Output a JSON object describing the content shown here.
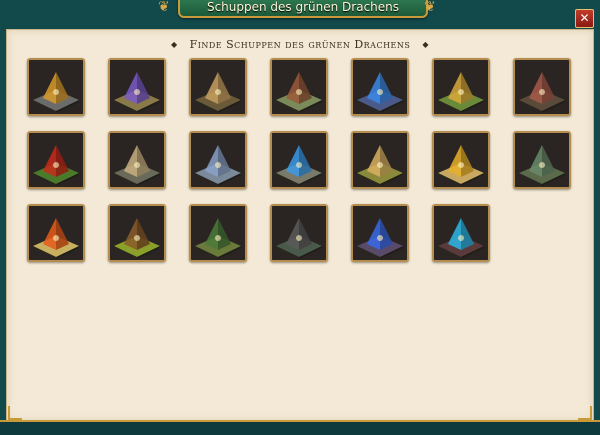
{
  "window": {
    "title": "Schuppen des grünen Drachens",
    "close_label": "✕"
  },
  "heading": {
    "text": "Finde Schuppen des grünen Drachens",
    "bullet": "◆"
  },
  "tiles": [
    {
      "icon": "lava-mountain-icon",
      "accent": "#d89a2a",
      "ground": "#6b6b6b"
    },
    {
      "icon": "horned-fortress-icon",
      "accent": "#7a5ac8",
      "ground": "#8a7a4a"
    },
    {
      "icon": "cathedral-icon",
      "accent": "#c8a060",
      "ground": "#6a5a3a"
    },
    {
      "icon": "ruined-village-icon",
      "accent": "#9a5a3a",
      "ground": "#7a8a5a"
    },
    {
      "icon": "blue-crystal-icon",
      "accent": "#3a8ae8",
      "ground": "#4a5a8a"
    },
    {
      "icon": "tree-cave-icon",
      "accent": "#d8a83a",
      "ground": "#6a8a3a"
    },
    {
      "icon": "dragon-skull-lair-icon",
      "accent": "#a85a4a",
      "ground": "#5a4a3a"
    },
    {
      "icon": "red-tree-icon",
      "accent": "#c82a1a",
      "ground": "#4a7a2a"
    },
    {
      "icon": "step-pyramid-icon",
      "accent": "#c8b080",
      "ground": "#6a6a5a"
    },
    {
      "icon": "mountain-temple-icon",
      "accent": "#8aa0c8",
      "ground": "#7a8a9a"
    },
    {
      "icon": "cliff-gate-icon",
      "accent": "#3a9ae8",
      "ground": "#7a7a6a"
    },
    {
      "icon": "desert-house-icon",
      "accent": "#d8b060",
      "ground": "#8a8a3a"
    },
    {
      "icon": "golden-pyramid-icon",
      "accent": "#e8b02a",
      "ground": "#c8a860"
    },
    {
      "icon": "stone-circle-icon",
      "accent": "#6a8a6a",
      "ground": "#5a6a4a"
    },
    {
      "icon": "fire-portal-icon",
      "accent": "#e85a1a",
      "ground": "#c8b060"
    },
    {
      "icon": "wooden-hut-icon",
      "accent": "#8a5a2a",
      "ground": "#8aa02a"
    },
    {
      "icon": "overgrown-ruin-icon",
      "accent": "#4a7a3a",
      "ground": "#6a7a3a"
    },
    {
      "icon": "dark-castle-icon",
      "accent": "#5a5a5a",
      "ground": "#4a5a4a"
    },
    {
      "icon": "blue-dragon-nest-icon",
      "accent": "#3a6ae8",
      "ground": "#5a4a6a"
    },
    {
      "icon": "demon-altar-icon",
      "accent": "#2ab8e8",
      "ground": "#5a3a3a"
    }
  ]
}
